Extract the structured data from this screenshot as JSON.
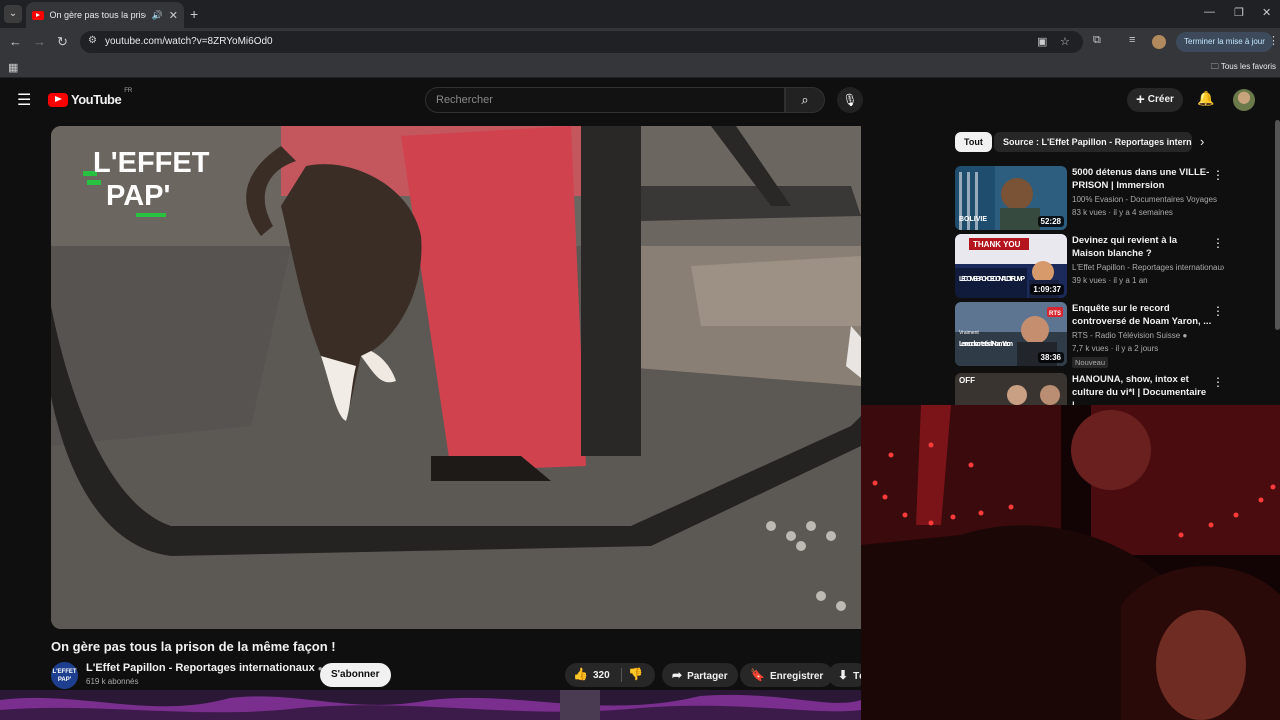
{
  "browser": {
    "tab_title": "On gère pas tous la prison",
    "url": "youtube.com/watch?v=8ZRYoMi6Od0",
    "update_button": "Terminer la mise à jour",
    "favorites_label": "Tous les favoris"
  },
  "header": {
    "logo_text": "YouTube",
    "country_code": "FR",
    "search_placeholder": "Rechercher",
    "create_label": "Créer"
  },
  "player": {
    "overlay_logo_line1": "L'EFFET",
    "overlay_logo_line2": "PAP'"
  },
  "video": {
    "title": "On gère pas tous la prison de la même façon !",
    "channel": "L'Effet Papillon - Reportages internationaux",
    "subscribers": "619 k abonnés",
    "subscribe_label": "S'abonner",
    "likes": "320",
    "share_label": "Partager",
    "save_label": "Enregistrer",
    "download_label": "Télécharger"
  },
  "sidebar": {
    "chip_all": "Tout",
    "chip_source": "Source : L'Effet Papillon - Reportages internationaux",
    "recommendations": [
      {
        "title": "5000 détenus dans une VILLE-PRISON | Immersion",
        "channel": "100% Evasion - Documentaires Voyages",
        "meta": "83 k vues · il y a 4 semaines",
        "duration": "52:28",
        "thumb_text": "BOLIVIE"
      },
      {
        "title": "Devinez qui revient à la Maison blanche ?",
        "channel": "L'Effet Papillon - Reportages internationaux",
        "meta": "39 k vues · il y a 1 an",
        "duration": "1:09:37",
        "thumb_text_top": "THANK YOU",
        "thumb_text_bottom": "LE COME-BACK DE DONALD TRUMP"
      },
      {
        "title": "Enquête sur le record controversé de Noam Yaron, ...",
        "channel": "RTS - Radio Télévision Suisse",
        "meta": "7,7 k vues · il y a 2 jours",
        "duration": "38:36",
        "badge": "Nouveau",
        "thumb_text": "Les records contestés de Noam Yaron",
        "thumb_brand": "RTS",
        "thumb_small": "Vraiment"
      },
      {
        "title": "HANOUNA, show, intox et culture du vi*l | Documentaire |...",
        "thumb_text": "OFF"
      }
    ]
  },
  "colors": {
    "yt_red": "#ff0000",
    "background": "#0f0f0f",
    "chip_active": "#f1f1f1",
    "logo_green": "#28c241"
  }
}
